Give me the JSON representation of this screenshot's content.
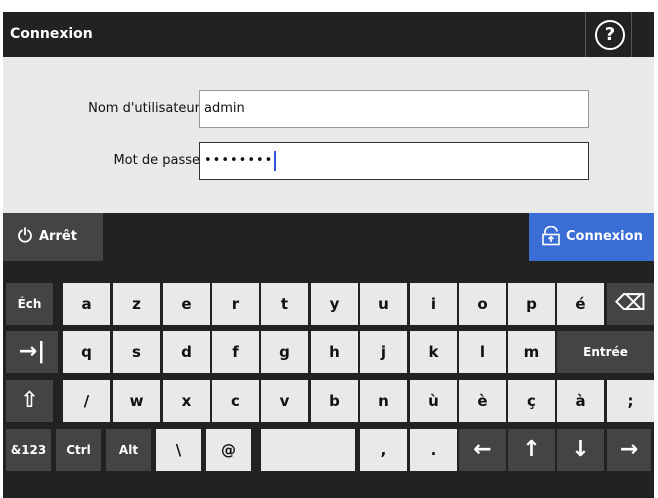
{
  "dialog": {
    "title": "Connexion",
    "help_glyph": "?",
    "username_label": "Nom d'utilisateur",
    "username_value": "admin",
    "password_label": "Mot de passe",
    "password_value": "••••••••",
    "stop_label": "Arrêt",
    "login_label": "Connexion"
  },
  "keyboard": {
    "row1": [
      {
        "id": "esc",
        "label": "Éch",
        "style": "dk"
      },
      {
        "id": "a",
        "label": "a",
        "style": "lt"
      },
      {
        "id": "z",
        "label": "z",
        "style": "lt"
      },
      {
        "id": "e",
        "label": "e",
        "style": "lt"
      },
      {
        "id": "r",
        "label": "r",
        "style": "lt"
      },
      {
        "id": "t",
        "label": "t",
        "style": "lt"
      },
      {
        "id": "y",
        "label": "y",
        "style": "lt"
      },
      {
        "id": "u",
        "label": "u",
        "style": "lt"
      },
      {
        "id": "i",
        "label": "i",
        "style": "lt"
      },
      {
        "id": "o",
        "label": "o",
        "style": "lt"
      },
      {
        "id": "p",
        "label": "p",
        "style": "lt"
      },
      {
        "id": "e-acute",
        "label": "é",
        "style": "lt"
      },
      {
        "id": "backspace",
        "label": "⌫",
        "style": "dk",
        "icon": "backspace-icon"
      }
    ],
    "row2": [
      {
        "id": "tab",
        "label": "→|",
        "style": "dk",
        "icon": "tab-icon"
      },
      {
        "id": "q",
        "label": "q",
        "style": "lt"
      },
      {
        "id": "s",
        "label": "s",
        "style": "lt"
      },
      {
        "id": "d",
        "label": "d",
        "style": "lt"
      },
      {
        "id": "f",
        "label": "f",
        "style": "lt"
      },
      {
        "id": "g",
        "label": "g",
        "style": "lt"
      },
      {
        "id": "h",
        "label": "h",
        "style": "lt"
      },
      {
        "id": "j",
        "label": "j",
        "style": "lt"
      },
      {
        "id": "k",
        "label": "k",
        "style": "lt"
      },
      {
        "id": "l",
        "label": "l",
        "style": "lt"
      },
      {
        "id": "m",
        "label": "m",
        "style": "lt"
      },
      {
        "id": "enter",
        "label": "Entrée",
        "style": "dk"
      }
    ],
    "row3": [
      {
        "id": "shift",
        "label": "⇧",
        "style": "dk",
        "icon": "shift-icon"
      },
      {
        "id": "slash",
        "label": "/",
        "style": "lt"
      },
      {
        "id": "w",
        "label": "w",
        "style": "lt"
      },
      {
        "id": "x",
        "label": "x",
        "style": "lt"
      },
      {
        "id": "c",
        "label": "c",
        "style": "lt"
      },
      {
        "id": "v",
        "label": "v",
        "style": "lt"
      },
      {
        "id": "b",
        "label": "b",
        "style": "lt"
      },
      {
        "id": "n",
        "label": "n",
        "style": "lt"
      },
      {
        "id": "u-grave",
        "label": "ù",
        "style": "lt"
      },
      {
        "id": "e-grave",
        "label": "è",
        "style": "lt"
      },
      {
        "id": "c-cedilla",
        "label": "ç",
        "style": "lt"
      },
      {
        "id": "a-grave",
        "label": "à",
        "style": "lt"
      },
      {
        "id": "semicolon",
        "label": ";",
        "style": "lt"
      }
    ],
    "row4": [
      {
        "id": "num",
        "label": "&123",
        "style": "dk"
      },
      {
        "id": "ctrl",
        "label": "Ctrl",
        "style": "dk"
      },
      {
        "id": "alt",
        "label": "Alt",
        "style": "dk"
      },
      {
        "id": "backslash",
        "label": "\\",
        "style": "lt"
      },
      {
        "id": "at",
        "label": "@",
        "style": "lt"
      },
      {
        "id": "space",
        "label": "",
        "style": "lt"
      },
      {
        "id": "comma",
        "label": ",",
        "style": "lt"
      },
      {
        "id": "period",
        "label": ".",
        "style": "lt"
      },
      {
        "id": "left",
        "label": "←",
        "style": "dk",
        "icon": "arrow-left-icon"
      },
      {
        "id": "up",
        "label": "↑",
        "style": "dk",
        "icon": "arrow-up-icon"
      },
      {
        "id": "down",
        "label": "↓",
        "style": "dk",
        "icon": "arrow-down-icon"
      },
      {
        "id": "right",
        "label": "→",
        "style": "dk",
        "icon": "arrow-right-icon"
      }
    ]
  },
  "colors": {
    "accent": "#3a6dd6",
    "titlebar": "#222222",
    "form_bg": "#e9e9e9",
    "key_dark": "#444444",
    "key_light": "#e9e9e9"
  }
}
